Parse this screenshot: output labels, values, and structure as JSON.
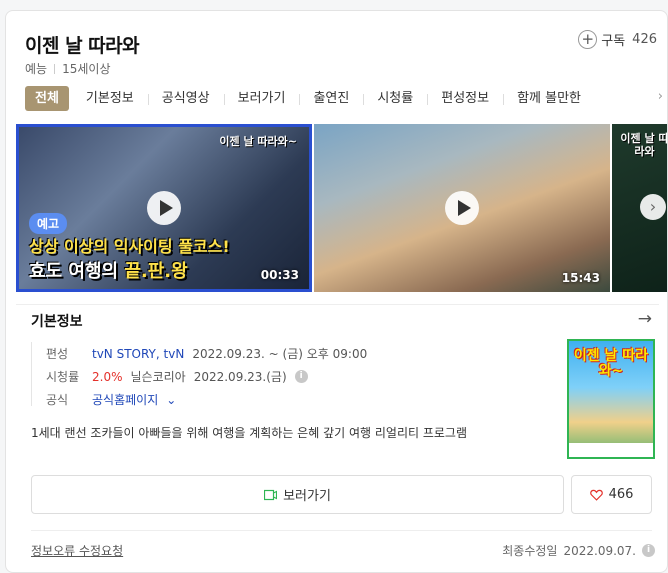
{
  "program": {
    "title": "이젠 날 따라와",
    "genre": "예능",
    "rating": "15세이상"
  },
  "subscribe": {
    "label": "구독",
    "count": "426"
  },
  "tabs": [
    "전체",
    "기본정보",
    "공식영상",
    "보러가기",
    "출연진",
    "시청률",
    "편성정보",
    "함께 볼만한"
  ],
  "videos": [
    {
      "badge": "예고",
      "caption_line1": "상상 이상의 익사이팅 풀코스!",
      "caption_line2_pre": "효도 여행의 ",
      "caption_line2_em": "끝.판.왕",
      "duration": "00:33",
      "logo": "이젠 날 따라와~"
    },
    {
      "duration": "15:43",
      "logo": ""
    },
    {
      "logo": "이젠 날 따라와"
    }
  ],
  "basic_info": {
    "section_title": "기본정보",
    "broadcast_label": "편성",
    "broadcast_channels": "tvN STORY, tvN",
    "broadcast_schedule": "2022.09.23. ~ (금) 오후 09:00",
    "rating_label": "시청률",
    "rating_value": "2.0%",
    "rating_source": "닐슨코리아",
    "rating_date": "2022.09.23.(금)",
    "official_label": "공식",
    "official_link": "공식홈페이지",
    "description": "1세대 랜선 조카들이 아빠들을 위해 여행을 계획하는 은혜 갚기 여행 리얼리티 프로그램",
    "poster_title": "이젠 날 따라와~"
  },
  "actions": {
    "watch_label": "보러가기",
    "like_count": "466"
  },
  "footer": {
    "report_label": "정보오류 수정요청",
    "updated_label": "최종수정일",
    "updated_date": "2022.09.07."
  },
  "colors": {
    "accent_tab": "#a89571",
    "link": "#1f47b8",
    "rating": "#e4312b",
    "watch_icon": "#2fb553",
    "heart": "#e4312b"
  }
}
